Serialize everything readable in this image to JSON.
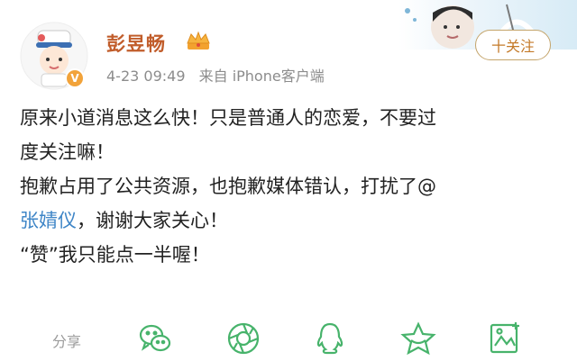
{
  "post": {
    "author": "彭昱畅",
    "time": "4-23 09:49",
    "source": "来自 iPhone客户端",
    "follow_label": "十关注",
    "lines": [
      "原来小道消息这么快！只是普通人的恋爱，不要过",
      "度关注嘛！",
      "抱歉占用了公共资源，也抱歉媒体错认，打扰了@"
    ],
    "mention": "张婧仪",
    "line4_rest": "，谢谢大家关心！",
    "line5": "“赞”我只能点一半喔！"
  },
  "share": {
    "label": "分享",
    "icons": [
      "wechat-icon",
      "moments-icon",
      "qq-icon",
      "favorite-icon",
      "screenshot-icon"
    ]
  },
  "colors": {
    "author": "#c15d2b",
    "mention": "#3f86c7",
    "share_icons": "#47b36b"
  }
}
